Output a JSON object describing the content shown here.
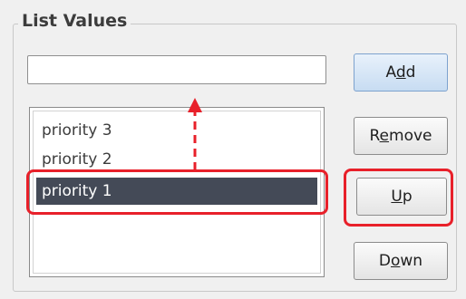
{
  "group": {
    "title": "List Values"
  },
  "input": {
    "value": ""
  },
  "list": {
    "items": [
      "priority 3",
      "priority 2",
      "priority 1"
    ],
    "selected_index": 2
  },
  "buttons": {
    "add": {
      "label": "Add",
      "mnemonic": "d"
    },
    "remove": {
      "label": "Remove",
      "mnemonic": "e"
    },
    "up": {
      "label": "Up",
      "mnemonic": "U"
    },
    "down": {
      "label": "Down",
      "mnemonic": "o"
    }
  },
  "annotations": {
    "highlight_color": "#e8202a",
    "selection_color": "#444a57",
    "arrow_direction": "up"
  }
}
